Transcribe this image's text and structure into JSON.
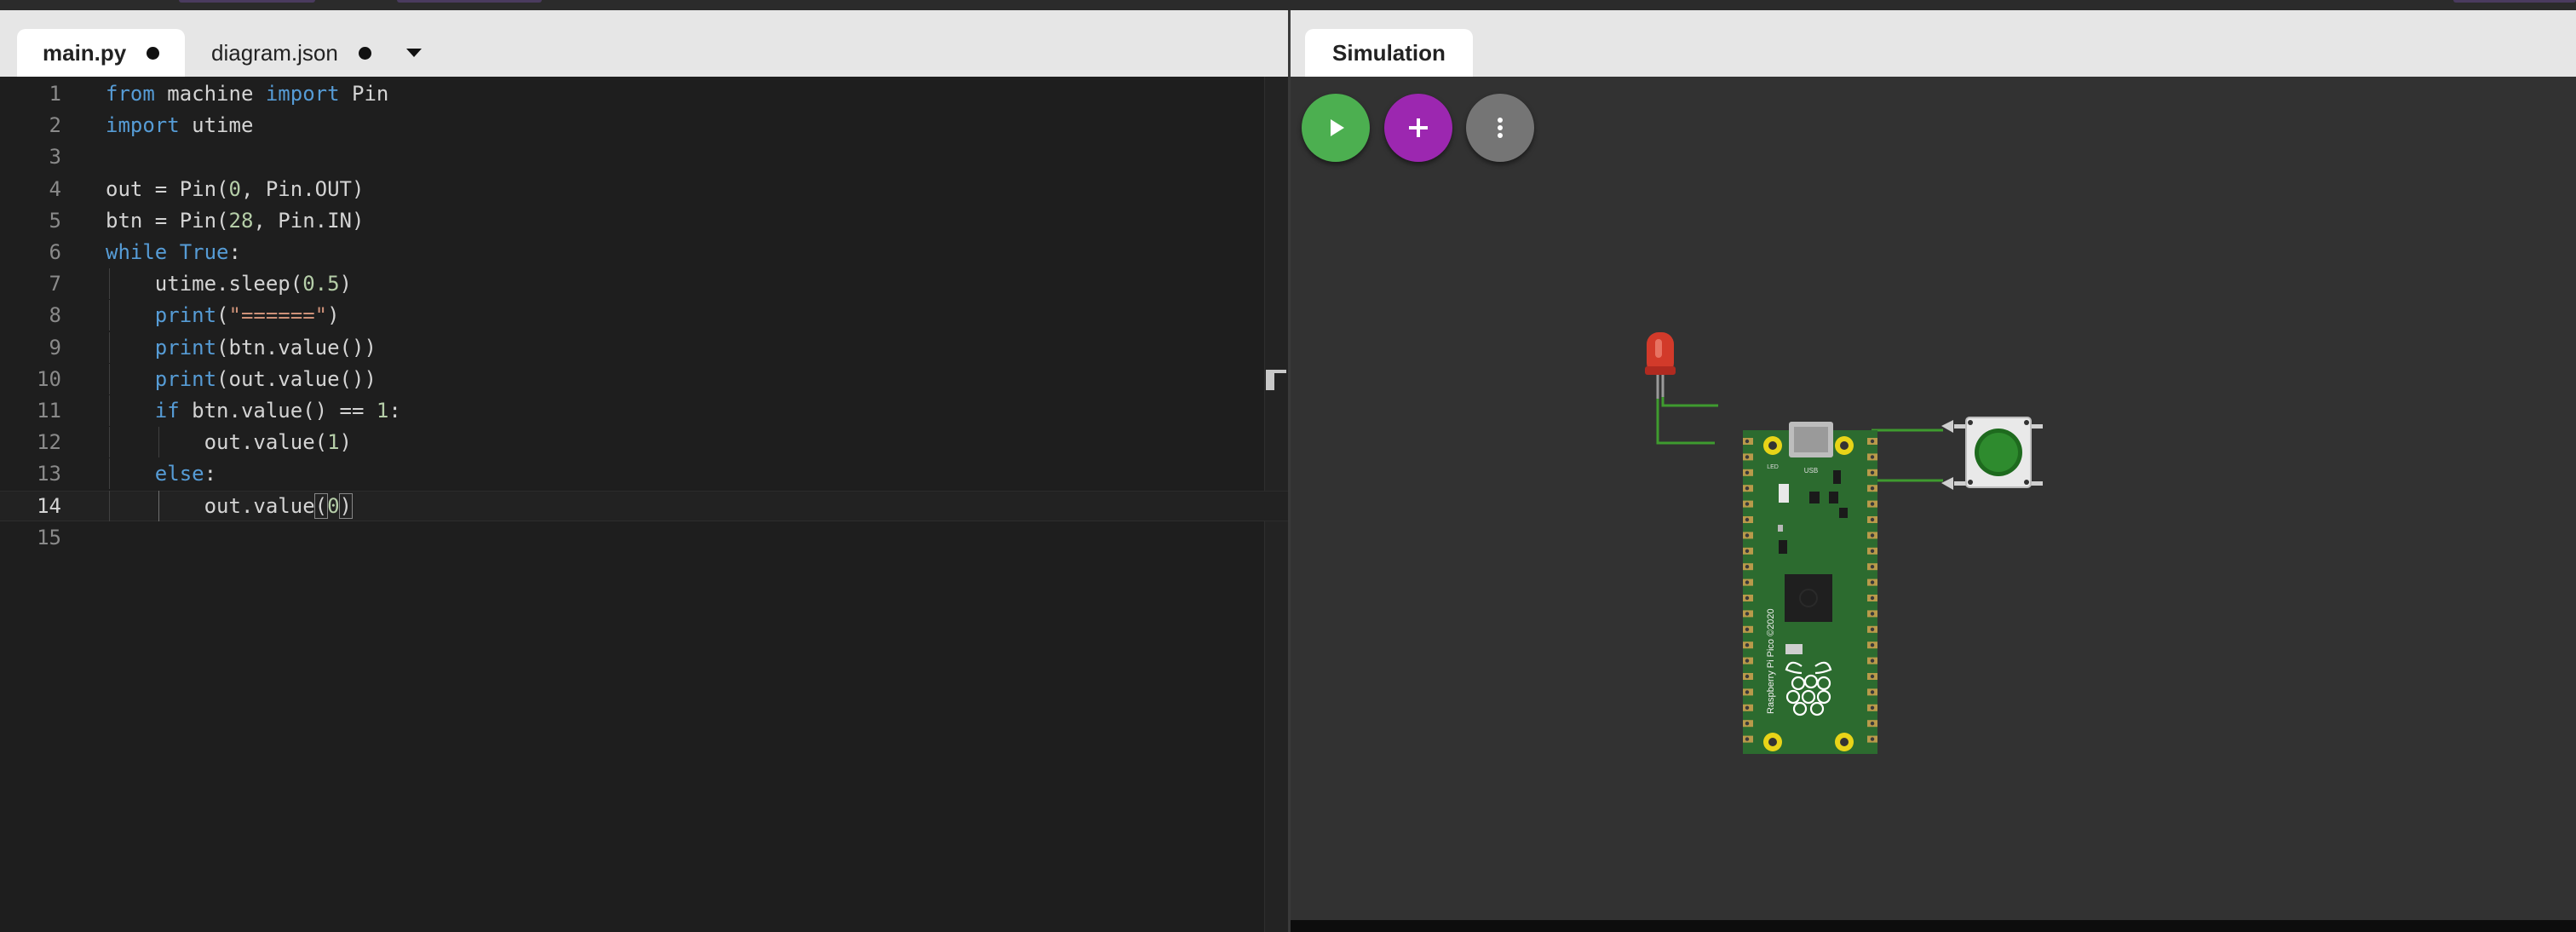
{
  "editor": {
    "tabs": [
      {
        "label": "main.py",
        "active": true,
        "modified": true
      },
      {
        "label": "diagram.json",
        "active": false,
        "modified": true
      }
    ],
    "current_line": 14,
    "lines": [
      {
        "n": "1",
        "code": "from machine import Pin"
      },
      {
        "n": "2",
        "code": "import utime"
      },
      {
        "n": "3",
        "code": ""
      },
      {
        "n": "4",
        "code": "out = Pin(0, Pin.OUT)"
      },
      {
        "n": "5",
        "code": "btn = Pin(28, Pin.IN)"
      },
      {
        "n": "6",
        "code": "while True:"
      },
      {
        "n": "7",
        "code": "    utime.sleep(0.5)"
      },
      {
        "n": "8",
        "code": "    print(\"======\")"
      },
      {
        "n": "9",
        "code": "    print(btn.value())"
      },
      {
        "n": "10",
        "code": "    print(out.value())"
      },
      {
        "n": "11",
        "code": "    if btn.value() == 1:"
      },
      {
        "n": "12",
        "code": "        out.value(1)"
      },
      {
        "n": "13",
        "code": "    else:"
      },
      {
        "n": "14",
        "code": "        out.value(0)"
      },
      {
        "n": "15",
        "code": ""
      }
    ]
  },
  "simulation": {
    "tab_label": "Simulation",
    "controls": [
      "play-icon",
      "plus-icon",
      "more-vertical-icon"
    ],
    "board": {
      "name": "Raspberry Pi Pico",
      "silkscreen": "Raspberry Pi Pico ©2020",
      "usb_label": "USB",
      "led_label": "LED"
    },
    "components": [
      "red-led",
      "green-pushbutton"
    ],
    "colors": {
      "board": "#2c6b2f",
      "wire": "#3f9b2f",
      "led": "#d23a2a",
      "button_cap": "#2e8b2e",
      "play": "#4caf50",
      "add": "#9c27b0",
      "more": "#757575"
    }
  }
}
